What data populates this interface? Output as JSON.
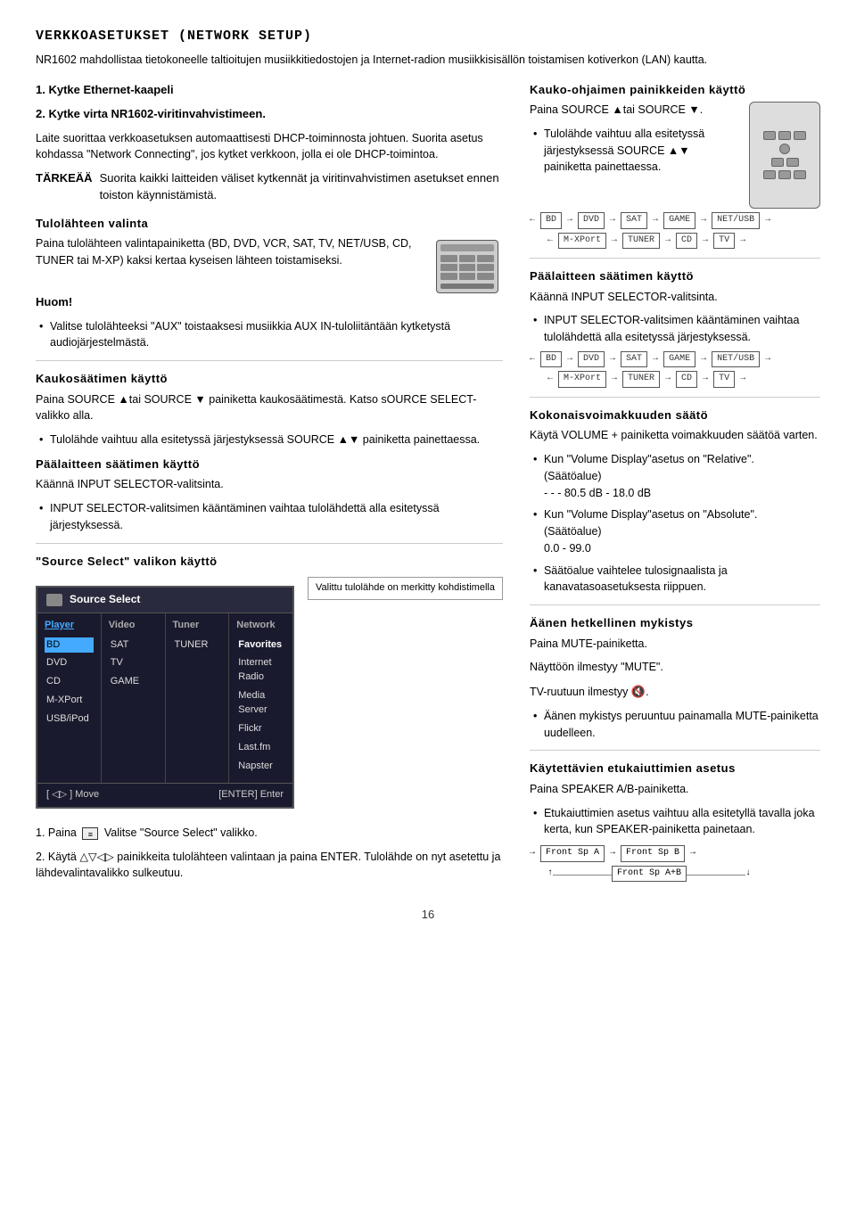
{
  "page": {
    "title": "VERKKOASETUKSET  (NETWORK  SETUP)",
    "subtitle": "NR1602 mahdollistaa tietokoneelle taltioitujen musiikkitiedostojen ja Internet-radion musiikkisisällön toistamisen kotiverkon (LAN) kautta.",
    "page_number": "16"
  },
  "left_col": {
    "ethernet_step": "1.  Kytke  Ethernet-kaapeli",
    "virite_step": "2.  Kytke  virta  NR1602-viritinvahvistimeen.",
    "dhcp_note": "Laite suorittaa verkkoasetuksen automaattisesti DHCP-toiminnosta johtuen.  Suorita asetus kohdassa \"Network Connecting\", jos kytket verkkoon, jolla ei ole DHCP-toimintoa.",
    "warning_title": "TÄRKEÄÄ",
    "warning_text": "Suorita kaikki laitteiden väliset kytkennät ja viritinvahvistimen asetukset ennen toiston käynnistämistä.",
    "source_select_title": "Tulolähteen  valinta",
    "source_select_text": "Paina tulolähteen valintapainiketta (BD, DVD, VCR, SAT, TV, NET/USB, CD, TUNER tai M-XP) kaksi kertaa kyseisen lähteen toistamiseksi.",
    "huom_title": "Huom!",
    "huom_bullet": "Valitse tulolähteeksi \"AUX\" toistaaksesi musiikkia AUX IN-tuloliitäntään kytketystä audiojärjestelmästä.",
    "kaukosaatimen_title": "Kaukosäätimen  käyttö",
    "kaukosaatimen_text": "Paina SOURCE ▲tai SOURCE ▼ painiketta kaukosäätimestä.  Katso sOURCE SELECT-valikko alla.",
    "tulolahde_bullet": "Tulolähde vaihtuu alla esitetyssä järjestyksessä SOURCE ▲▼ painiketta painettaessa.",
    "paalaitteen_title": "Päälaitteen  säätimen  käyttö",
    "paalaitteen_text": "Käännä INPUT SELECTOR-valitsinta.",
    "input_selector_bullet": "INPUT SELECTOR-valitsimen kääntäminen vaihtaa tulolähdettä alla esitetyssä järjestyksessä.",
    "source_select_valikon_title": "\"Source Select\" valikon  käyttö",
    "step1_label": "1.  Paina",
    "step1_text": "Valitse \"Source Select\" valikko.",
    "step2_text": "2.  Käytä △▽◁▷ painikkeita tulolähteen valintaan ja paina ENTER. Tulolähde on nyt asetettu ja lähdevalintavalikko sulkeutuu.",
    "source_select_ui": {
      "header": "Source Select",
      "tooltip": "Valittu tulolähde on merkitty kohdistimella",
      "col_player": "Player",
      "col_video": "Video",
      "col_tuner": "Tuner",
      "col_network": "Network",
      "player_items": [
        "BD",
        "DVD",
        "CD",
        "M-XPort",
        "USB/iPod"
      ],
      "video_items": [
        "SAT",
        "TV",
        "GAME"
      ],
      "tuner_items": [
        "TUNER"
      ],
      "network_items": [
        "Favorites",
        "Internet Radio",
        "Media Server",
        "Flickr",
        "Last.fm",
        "Napster"
      ],
      "footer_move": "[ ◁▷ ] Move",
      "footer_enter": "[ENTER] Enter"
    }
  },
  "right_col": {
    "kauko_ohjaimen_title": "Kauko-ohjaimen  painikkeiden  käyttö",
    "kauko_text": "Paina SOURCE ▲tai SOURCE ▼.",
    "kauko_bullet": "Tulolähde vaihtuu alla esitetyssä järjestyksessä SOURCE ▲▼ painiketta painettaessa.",
    "selector_bar1_items": [
      "BD",
      "DVD",
      "SAT",
      "GAME",
      "NET/USB"
    ],
    "selector_bar2_items": [
      "M-XPort",
      "TUNER",
      "CD",
      "TV"
    ],
    "paalaitteen2_title": "Päälaitteen  säätimen  käyttö",
    "paalaitteen2_text": "Käännä INPUT SELECTOR-valitsinta.",
    "input2_bullet": "INPUT SELECTOR-valitsimen kääntäminen vaihtaa tulolähdettä alla esitetyssä järjestyksessä.",
    "selector_bar3_items": [
      "BD",
      "DVD",
      "SAT",
      "GAME",
      "NET/USB"
    ],
    "selector_bar4_items": [
      "M-XPort",
      "TUNER",
      "CD",
      "TV"
    ],
    "kokonais_title": "Kokonaisvoimakkuuden  säätö",
    "kokonais_text": "Käytä VOLUME + painiketta voimakkuuden säätöä varten.",
    "relative_bullet": "Kun \"Volume Display\"asetus on \"Relative\". (Säätöalue)\n- - -  80.5 dB - 18.0 dB",
    "absolute_bullet": "Kun \"Volume Display\"asetus on \"Absolute\". (Säätöalue)\n0.0 - 99.0",
    "saato_bullet": "Säätöalue vaihtelee tulosignaalista ja kanavatasoasetuksesta riippuen.",
    "aanen_title": "Äänen  hetkellinen  mykistys",
    "aanen_text1": "Paina MUTE-painiketta.",
    "aanen_text2": "Näyttöön ilmestyy \"MUTE\".",
    "aanen_text3": "TV-ruutuun ilmestyy 🔇.",
    "aanen_bullet": "Äänen mykistys peruuntuu painamalla MUTE-painiketta uudelleen.",
    "kaytettavien_title": "Käytettävien  etukaiuttimien  asetus",
    "kaytettavien_text": "Paina SPEAKER A/B-painiketta.",
    "speaker_bullet": "Etukaiuttimien asetus vaihtuu alla esitetyllä tavalla joka kerta, kun SPEAKER-painiketta painetaan.",
    "speaker_bar": [
      "Front Sp A",
      "Front Sp B"
    ],
    "speaker_bar2": "Front Sp A+B"
  }
}
